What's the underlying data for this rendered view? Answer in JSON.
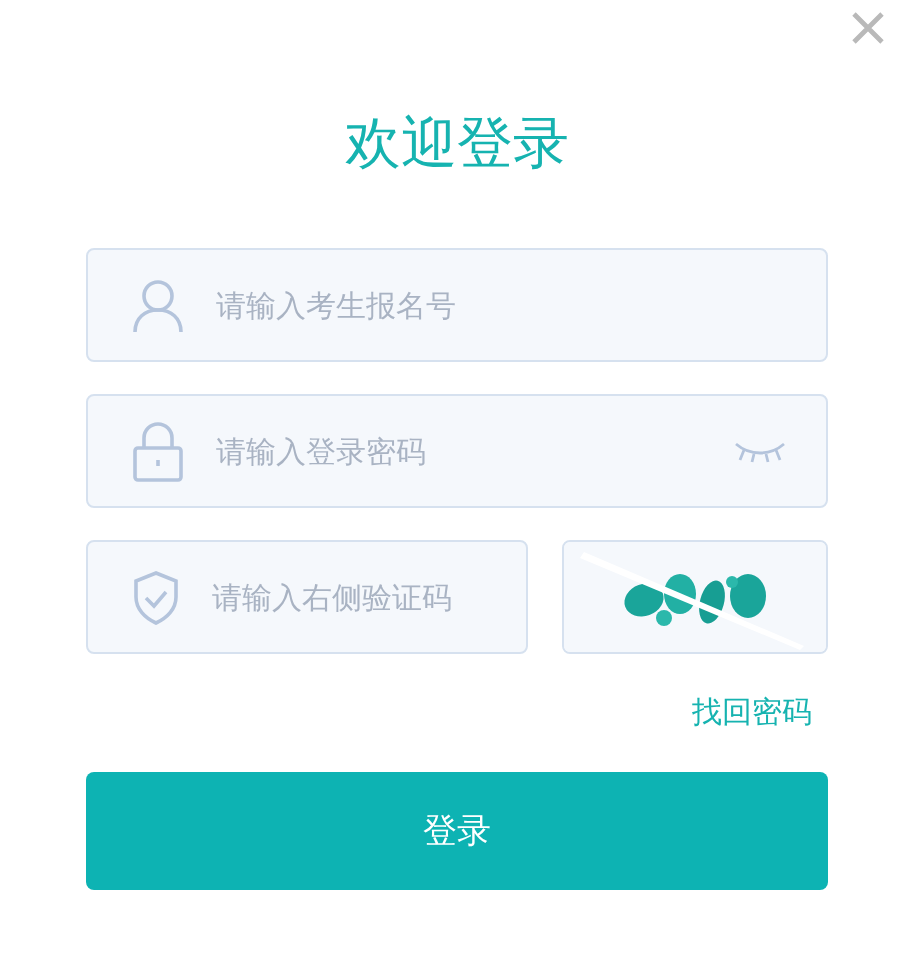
{
  "title": "欢迎登录",
  "fields": [
    {
      "kind": "user",
      "placeholder": "请输入考生报名号"
    },
    {
      "kind": "password",
      "placeholder": "请输入登录密码"
    }
  ],
  "captcha_field": {
    "placeholder": "请输入右侧验证码"
  },
  "forgot_link": "找回密码",
  "login_button": "登录"
}
